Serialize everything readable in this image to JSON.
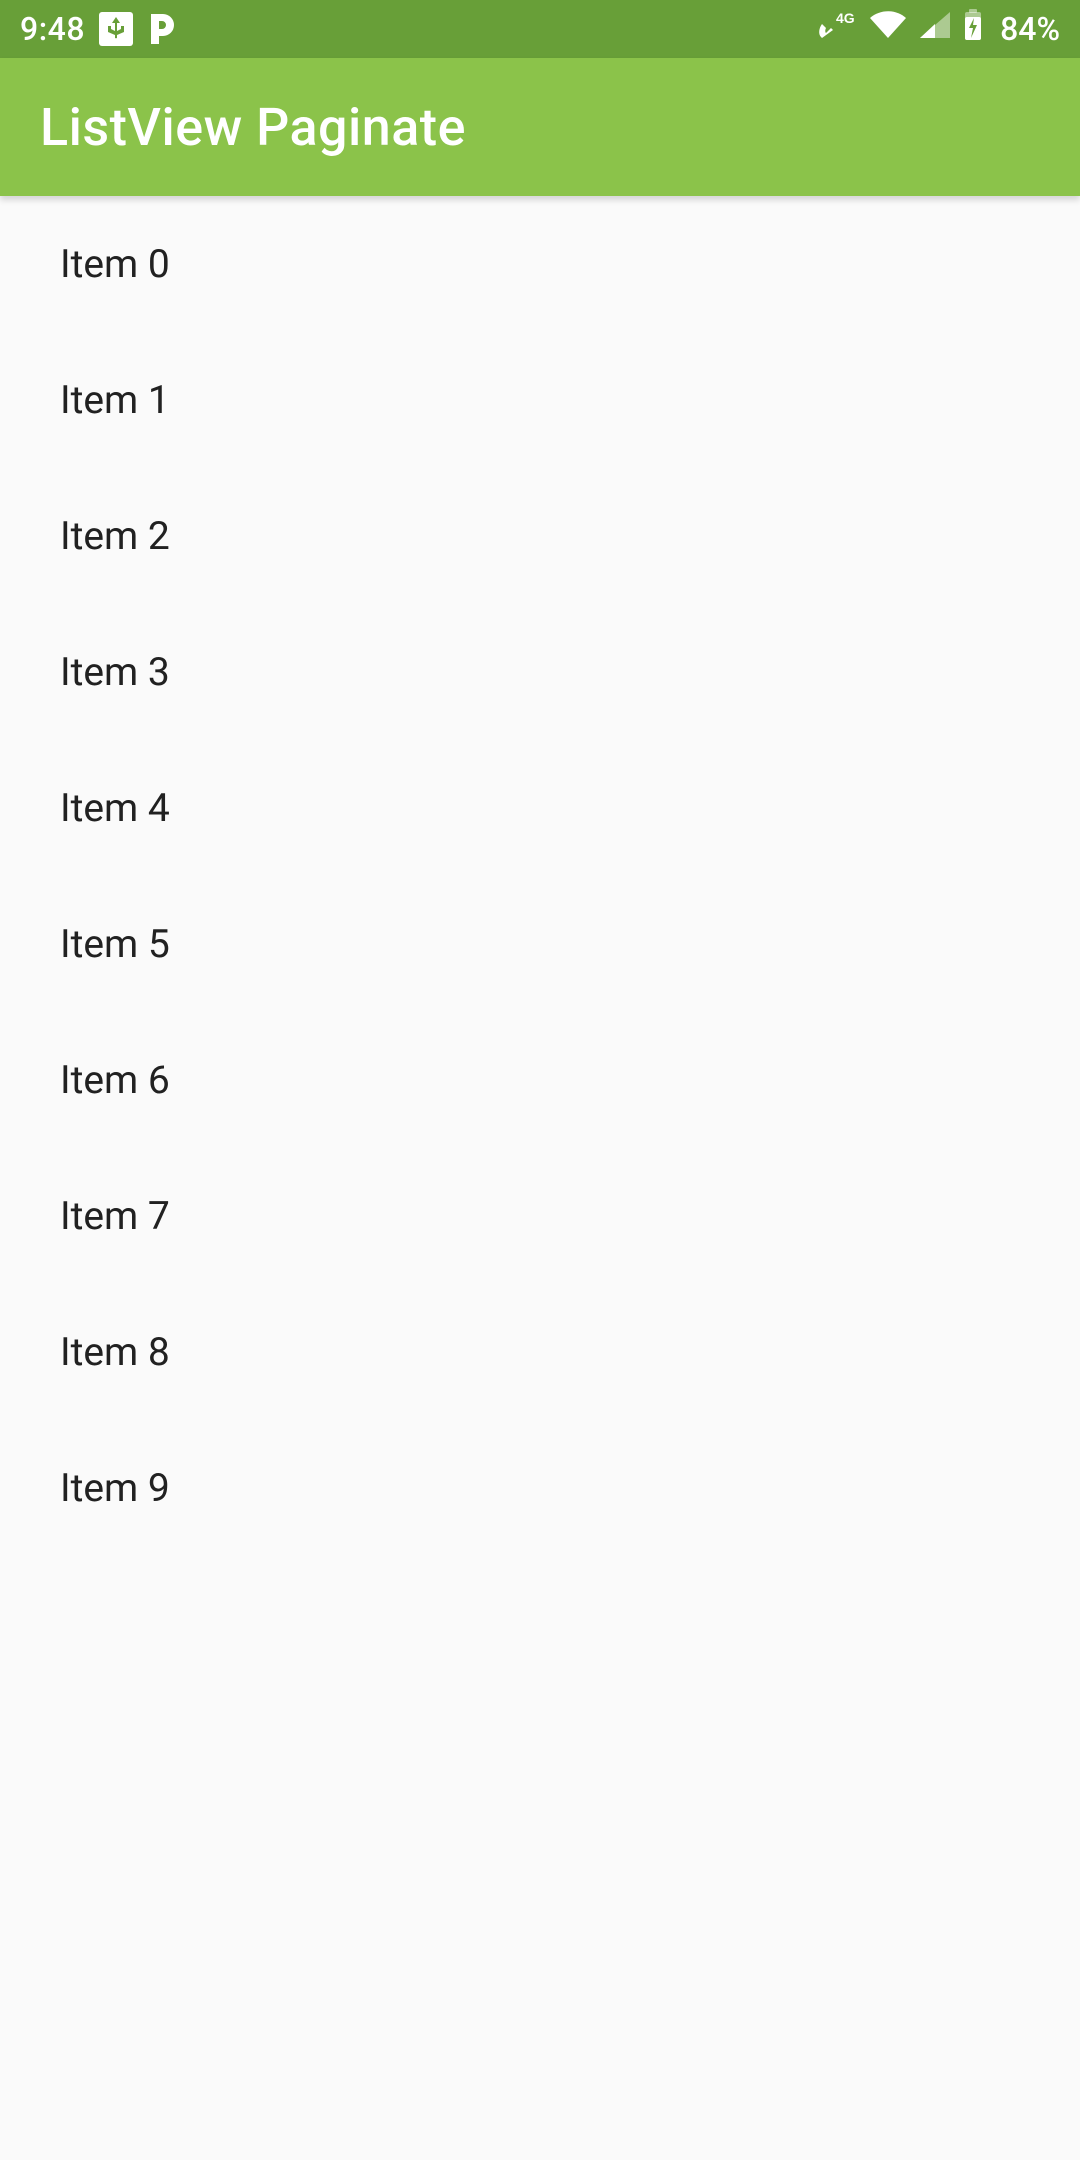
{
  "status": {
    "time": "9:48",
    "battery_pct": "84%"
  },
  "appbar": {
    "title": "ListView Paginate"
  },
  "list": {
    "items": [
      {
        "label": "Item 0"
      },
      {
        "label": "Item 1"
      },
      {
        "label": "Item 2"
      },
      {
        "label": "Item 3"
      },
      {
        "label": "Item 4"
      },
      {
        "label": "Item 5"
      },
      {
        "label": "Item 6"
      },
      {
        "label": "Item 7"
      },
      {
        "label": "Item 8"
      },
      {
        "label": "Item 9"
      }
    ]
  }
}
